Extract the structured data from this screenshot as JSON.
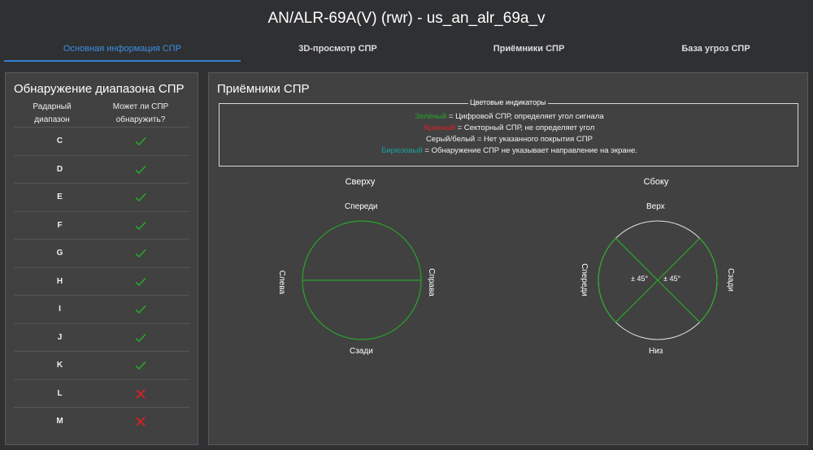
{
  "window": {
    "title": "AN/ALR-69A(V) (rwr) - us_an_alr_69a_v"
  },
  "tabs": [
    {
      "label": "Основная информация СПР",
      "active": true
    },
    {
      "label": "3D-просмотр СПР",
      "active": false
    },
    {
      "label": "Приёмники СПР",
      "active": false
    },
    {
      "label": "База угроз СПР",
      "active": false
    }
  ],
  "detection": {
    "title": "Обнаружение диапазона СПР",
    "col_band": "Радарный диапазон",
    "col_detect": "Может ли СПР обнаружить?",
    "rows": [
      {
        "band": "C",
        "detect": "check-icon"
      },
      {
        "band": "D",
        "detect": "check-icon"
      },
      {
        "band": "E",
        "detect": "check-icon"
      },
      {
        "band": "F",
        "detect": "check-icon"
      },
      {
        "band": "G",
        "detect": "check-icon"
      },
      {
        "band": "H",
        "detect": "check-icon"
      },
      {
        "band": "I",
        "detect": "check-icon"
      },
      {
        "band": "J",
        "detect": "check-icon"
      },
      {
        "band": "K",
        "detect": "check-icon"
      },
      {
        "band": "L",
        "detect": "cross-icon"
      },
      {
        "band": "M",
        "detect": "cross-icon"
      }
    ]
  },
  "receivers": {
    "title": "Приёмники СПР",
    "legend": {
      "title": "Цветовые индикаторы",
      "green_word": "Зелёный",
      "green_text": " = Цифровой СПР, определяет угол сигнала",
      "red_word": "Красный",
      "red_text": " = Секторный СПР, не определяет угол",
      "gray_text": "Серый/белый = Нет указанного покрытия СПР",
      "teal_word": "Бирюзовый",
      "teal_text": " = Обнаружение СПР не указывает направление на экране."
    },
    "top_view": {
      "title": "Сверху",
      "front": "Спереди",
      "back": "Сзади",
      "left": "Слева",
      "right": "Справа"
    },
    "side_view": {
      "title": "Сбоку",
      "top": "Верх",
      "bottom": "Низ",
      "front": "Спереди",
      "back": "Сзади",
      "angle_left": "± 45°",
      "angle_right": "± 45°"
    }
  },
  "colors": {
    "green": "#2aa52a",
    "red": "#e02020",
    "teal": "#1aa0a0",
    "accent": "#3a8fe3",
    "white": "#e0e0e0"
  }
}
